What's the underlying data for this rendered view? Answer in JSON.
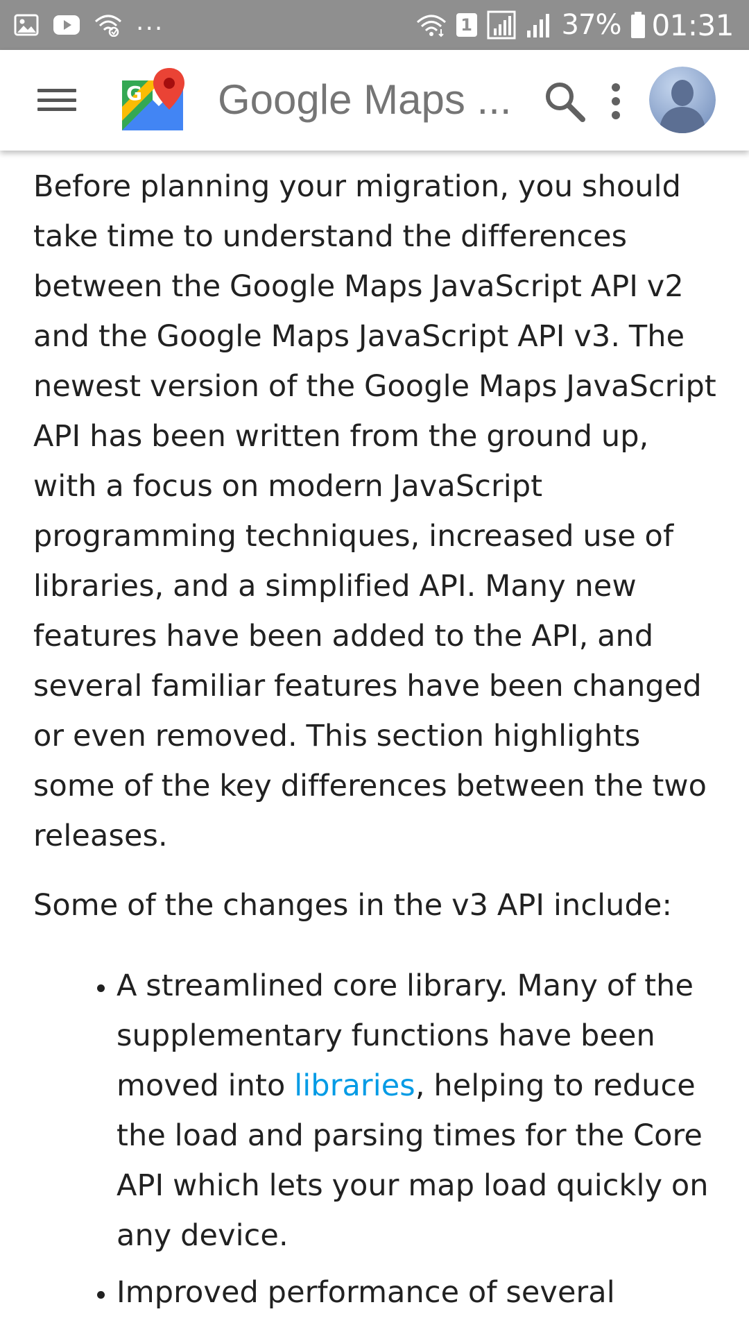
{
  "status_bar": {
    "left_overflow": "...",
    "battery_percent": "37%",
    "time": "01:31",
    "sim_slot": "1",
    "icons": [
      "image-icon",
      "youtube-icon",
      "wifi-icon",
      "wifi-icon",
      "sim-icon",
      "signal-icon",
      "signal-icon",
      "battery-icon"
    ]
  },
  "app_bar": {
    "title": "Google Maps ...",
    "logo_letter": "G",
    "colors": {
      "maps_green": "#34a853",
      "maps_blue": "#4285f4",
      "maps_yellow": "#fbbc04",
      "maps_red": "#ea4335"
    }
  },
  "article": {
    "paragraph_1": "Before planning your migration, you should take time to understand the differences between the Google Maps JavaScript API v2 and the Google Maps JavaScript API v3. The newest version of the Google Maps JavaScript API has been written from the ground up, with a focus on modern JavaScript programming techniques, increased use of libraries, and a simplified API. Many new features have been added to the API, and several familiar features have been changed or even removed. This section highlights some of the key differences between the two releases.",
    "paragraph_2": "Some of the changes in the v3 API include:",
    "bullets": [
      {
        "before_link": "A streamlined core library. Many of the supplementary functions have been moved into ",
        "link": "libraries",
        "after_link": ", helping to reduce the load and parsing times for the Core API which lets your map load quickly on any device."
      },
      {
        "text": "Improved performance of several"
      }
    ],
    "link_color": "#039be5"
  }
}
